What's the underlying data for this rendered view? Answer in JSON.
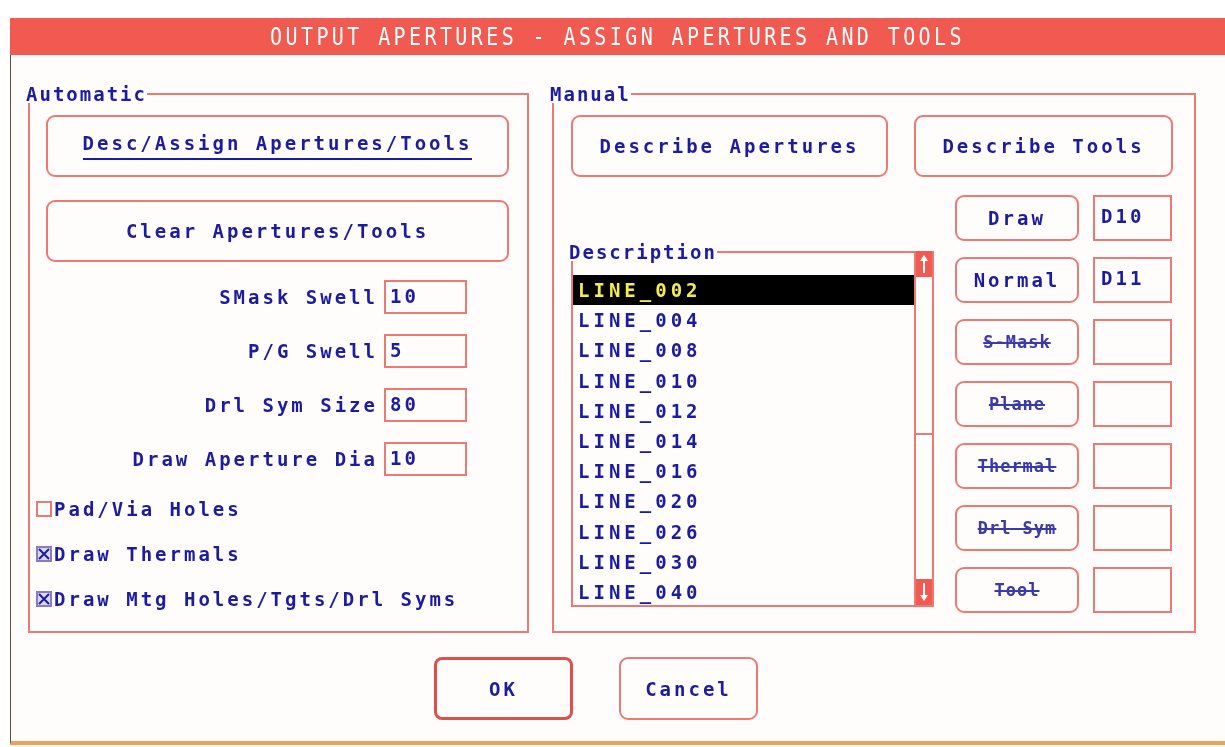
{
  "window": {
    "title": "OUTPUT APERTURES - ASSIGN APERTURES AND TOOLS"
  },
  "automatic": {
    "legend": "Automatic",
    "buttons": [
      {
        "label": "Desc/Assign Apertures/Tools",
        "focused": true
      },
      {
        "label": "Clear Apertures/Tools",
        "focused": false
      }
    ],
    "fields": [
      {
        "label": "SMask Swell",
        "value": "10"
      },
      {
        "label": "P/G Swell",
        "value": "5"
      },
      {
        "label": "Drl Sym Size",
        "value": "80"
      },
      {
        "label": "Draw Aperture Dia",
        "value": "10"
      }
    ],
    "checkboxes": [
      {
        "label": "Pad/Via Holes",
        "checked": false
      },
      {
        "label": "Draw Thermals",
        "checked": true
      },
      {
        "label": "Draw Mtg Holes/Tgts/Drl Syms",
        "checked": true
      }
    ]
  },
  "manual": {
    "legend": "Manual",
    "buttons": [
      {
        "label": "Describe Apertures"
      },
      {
        "label": "Describe Tools"
      }
    ],
    "description": {
      "legend": "Description",
      "items": [
        {
          "label": "LINE_002",
          "selected": true
        },
        {
          "label": "LINE_004",
          "selected": false
        },
        {
          "label": "LINE_008",
          "selected": false
        },
        {
          "label": "LINE_010",
          "selected": false
        },
        {
          "label": "LINE_012",
          "selected": false
        },
        {
          "label": "LINE_014",
          "selected": false
        },
        {
          "label": "LINE_016",
          "selected": false
        },
        {
          "label": "LINE_020",
          "selected": false
        },
        {
          "label": "LINE_026",
          "selected": false
        },
        {
          "label": "LINE_030",
          "selected": false
        },
        {
          "label": "LINE_040",
          "selected": false
        }
      ]
    },
    "assignments": [
      {
        "label": "Draw",
        "disabled": false,
        "value": "D10"
      },
      {
        "label": "Normal",
        "disabled": false,
        "value": "D11"
      },
      {
        "label": "S-Mask",
        "disabled": true
      },
      {
        "label": "Plane",
        "disabled": true
      },
      {
        "label": "Thermal",
        "disabled": true
      },
      {
        "label": "Drl Sym",
        "disabled": true
      },
      {
        "label": "Tool",
        "disabled": true
      }
    ]
  },
  "buttons": [
    {
      "label": "OK",
      "default": true
    },
    {
      "label": "Cancel",
      "default": false
    }
  ]
}
